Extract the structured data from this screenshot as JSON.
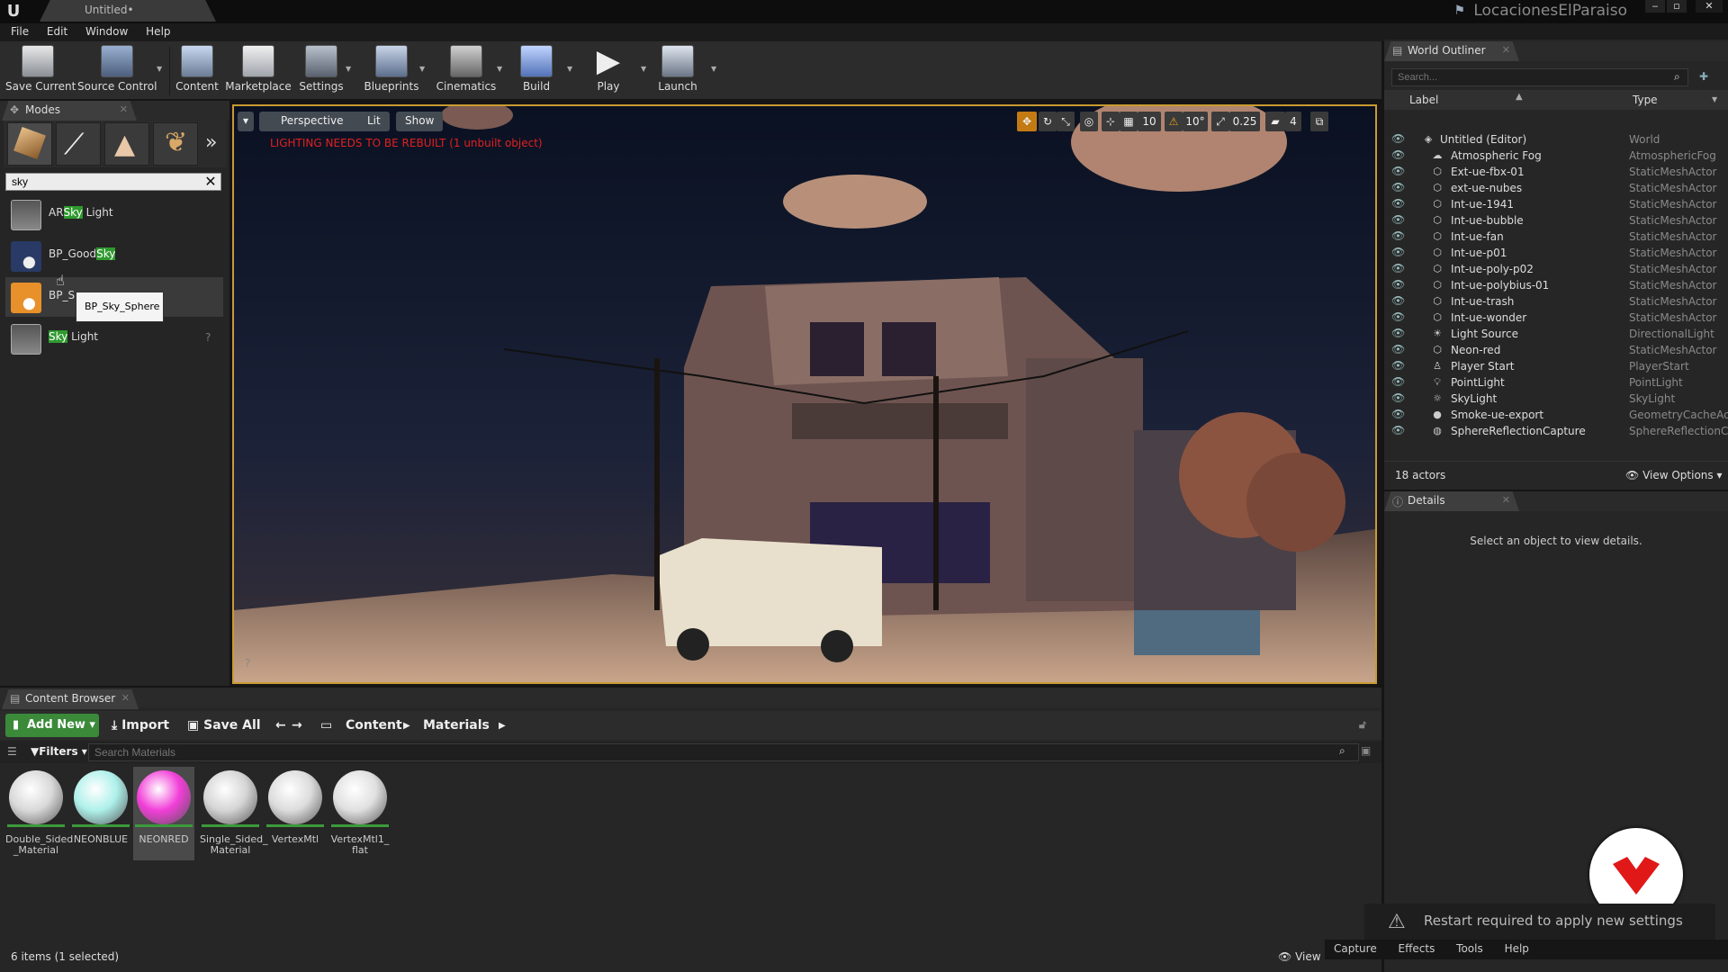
{
  "window": {
    "app_logo": "U",
    "doc_tab": "Untitled•",
    "project": "LocacionesElParaiso",
    "controls": {
      "minimize": "‒",
      "maximize": "▫",
      "close": "✕"
    }
  },
  "menu": [
    "File",
    "Edit",
    "Window",
    "Help"
  ],
  "toolbar": [
    {
      "label": "Save Current",
      "icon": "save-icon"
    },
    {
      "label": "Source Control",
      "icon": "source-control-icon"
    },
    {
      "label": "Content",
      "icon": "content-icon"
    },
    {
      "label": "Marketplace",
      "icon": "marketplace-icon"
    },
    {
      "label": "Settings",
      "icon": "settings-icon"
    },
    {
      "label": "Blueprints",
      "icon": "blueprints-icon"
    },
    {
      "label": "Cinematics",
      "icon": "cinematics-icon"
    },
    {
      "label": "Build",
      "icon": "build-icon"
    },
    {
      "label": "Play",
      "icon": "play-icon"
    },
    {
      "label": "Launch",
      "icon": "launch-icon"
    }
  ],
  "modes": {
    "tab": "Modes",
    "search_value": "sky",
    "results": [
      {
        "pre": "AR",
        "hit": "Sky",
        "post": " Light"
      },
      {
        "pre": "BP_Good",
        "hit": "Sky",
        "post": ""
      },
      {
        "pre": "BP_S",
        "hit": "",
        "post": ""
      },
      {
        "pre": "",
        "hit": "Sky",
        "post": " Light"
      }
    ],
    "tooltip": "BP_Sky_Sphere"
  },
  "viewport": {
    "perspective": "Perspective",
    "lit": "Lit",
    "show": "Show",
    "warning": "LIGHTING NEEDS TO BE REBUILT (1 unbuilt object)",
    "grid_snap": "10",
    "rot_snap": "10°",
    "scale_snap": "0.25",
    "camera_speed": "4"
  },
  "content_browser": {
    "tab": "Content Browser",
    "add_new": "Add New",
    "import": "Import",
    "save_all": "Save All",
    "path": [
      "Content",
      "Materials"
    ],
    "filters": "Filters",
    "search_placeholder": "Search Materials",
    "materials": [
      {
        "name": "Double_Sided\n_Material",
        "color": "#d9d9d9"
      },
      {
        "name": "NEONBLUE",
        "color": "#aef0ea"
      },
      {
        "name": "NEONRED",
        "color": "#f23fd8"
      },
      {
        "name": "Single_Sided_\nMaterial",
        "color": "#d5d5d5"
      },
      {
        "name": "VertexMtl",
        "color": "#dcdcdc"
      },
      {
        "name": "VertexMtl1_\nflat",
        "color": "#e0e0e0"
      }
    ],
    "status": "6 items (1 selected)",
    "view_options": "View Options"
  },
  "outliner": {
    "tab": "World Outliner",
    "search_placeholder": "Search...",
    "col_label": "Label",
    "col_type": "Type",
    "rows": [
      {
        "label": "Untitled (Editor)",
        "type": "World",
        "icon": "world-icon"
      },
      {
        "label": "Atmospheric Fog",
        "type": "AtmosphericFog",
        "icon": "fog-icon"
      },
      {
        "label": "Ext-ue-fbx-01",
        "type": "StaticMeshActor",
        "icon": "mesh-icon"
      },
      {
        "label": "ext-ue-nubes",
        "type": "StaticMeshActor",
        "icon": "mesh-icon"
      },
      {
        "label": "Int-ue-1941",
        "type": "StaticMeshActor",
        "icon": "mesh-icon"
      },
      {
        "label": "Int-ue-bubble",
        "type": "StaticMeshActor",
        "icon": "mesh-icon"
      },
      {
        "label": "Int-ue-fan",
        "type": "StaticMeshActor",
        "icon": "mesh-icon"
      },
      {
        "label": "Int-ue-p01",
        "type": "StaticMeshActor",
        "icon": "mesh-icon"
      },
      {
        "label": "Int-ue-poly-p02",
        "type": "StaticMeshActor",
        "icon": "mesh-icon"
      },
      {
        "label": "Int-ue-polybius-01",
        "type": "StaticMeshActor",
        "icon": "mesh-icon"
      },
      {
        "label": "Int-ue-trash",
        "type": "StaticMeshActor",
        "icon": "mesh-icon"
      },
      {
        "label": "Int-ue-wonder",
        "type": "StaticMeshActor",
        "icon": "mesh-icon"
      },
      {
        "label": "Light Source",
        "type": "DirectionalLight",
        "icon": "sun-icon"
      },
      {
        "label": "Neon-red",
        "type": "StaticMeshActor",
        "icon": "mesh-icon"
      },
      {
        "label": "Player Start",
        "type": "PlayerStart",
        "icon": "player-icon"
      },
      {
        "label": "PointLight",
        "type": "PointLight",
        "icon": "bulb-icon"
      },
      {
        "label": "SkyLight",
        "type": "SkyLight",
        "icon": "skylight-icon"
      },
      {
        "label": "Smoke-ue-export",
        "type": "GeometryCacheAc",
        "icon": "sphere-icon"
      },
      {
        "label": "SphereReflectionCapture",
        "type": "SphereReflectionC",
        "icon": "reflection-icon"
      }
    ],
    "actor_count": "18 actors",
    "view_options": "View Options"
  },
  "details": {
    "tab": "Details",
    "empty": "Select an object to view details."
  },
  "notification": {
    "text": "Restart required to apply new settings"
  },
  "bottom_menu": [
    "Capture",
    "Effects",
    "Tools",
    "Help"
  ]
}
